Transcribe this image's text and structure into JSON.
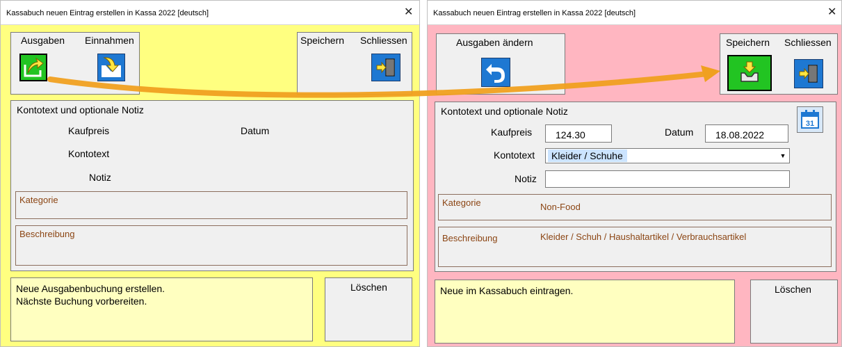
{
  "left": {
    "title": "Kassabuch neuen Eintrag erstellen in Kassa 2022   [deutsch]",
    "close_glyph": "✕",
    "ausgaben_label": "Ausgaben",
    "einnahmen_label": "Einnahmen",
    "speichern_label": "Speichern",
    "schliessen_label": "Schliessen",
    "section_title": "Kontotext und optionale Notiz",
    "kaufpreis_label": "Kaufpreis",
    "datum_label": "Datum",
    "kontotext_label": "Kontotext",
    "notiz_label": "Notiz",
    "kategorie_label": "Kategorie",
    "beschreibung_label": "Beschreibung",
    "message_line1": "Neue Ausgabenbuchung erstellen.",
    "message_line2": "Nächste Buchung vorbereiten.",
    "loeschen_label": "Löschen"
  },
  "right": {
    "title": "Kassabuch neuen Eintrag erstellen in Kassa 2022   [deutsch]",
    "close_glyph": "✕",
    "ausgaben_aendern_label": "Ausgaben ändern",
    "speichern_label": "Speichern",
    "schliessen_label": "Schliessen",
    "section_title": "Kontotext und optionale Notiz",
    "kaufpreis_label": "Kaufpreis",
    "kaufpreis_value": "124.30",
    "datum_label": "Datum",
    "datum_value": "18.08.2022",
    "calendar_day": "31",
    "kontotext_label": "Kontotext",
    "kontotext_value": "Kleider / Schuhe",
    "notiz_label": "Notiz",
    "notiz_value": "",
    "kategorie_label": "Kategorie",
    "kategorie_value": "Non-Food",
    "beschreibung_label": "Beschreibung",
    "beschreibung_value": "Kleider / Schuh / Haushaltartikel / Verbrauchsartikel",
    "message": "Neue im Kassabuch eintragen.",
    "loeschen_label": "Löschen"
  },
  "colors": {
    "left_background": "#ffff80",
    "right_background": "#ffb6c1",
    "message_background": "#ffffc0",
    "arrow": "#f0a020",
    "icon_blue": "#1e78d2",
    "icon_green": "#22c422"
  }
}
